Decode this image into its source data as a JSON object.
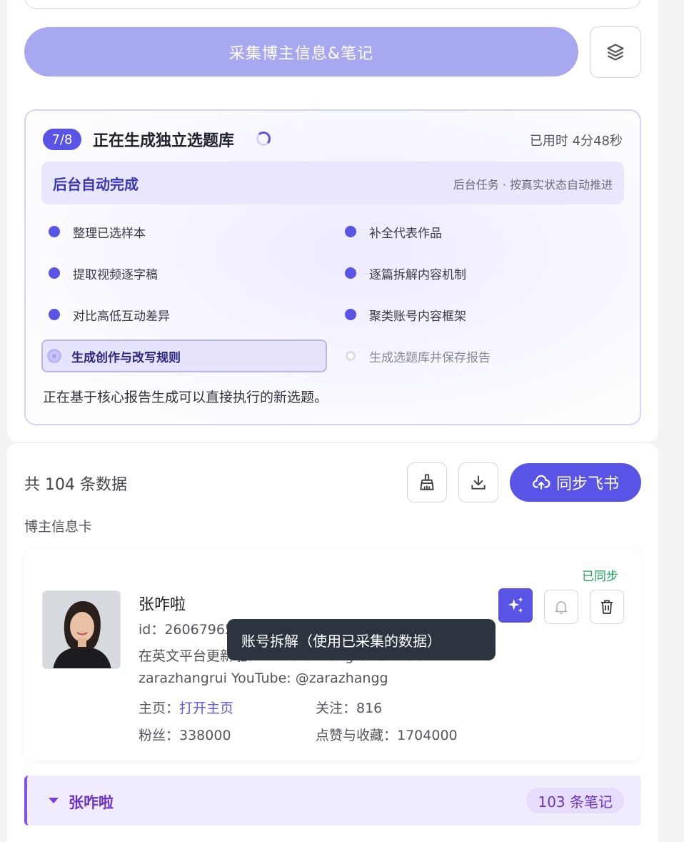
{
  "collect": {
    "button_label": "采集博主信息&笔记"
  },
  "progress": {
    "step_badge": "7/8",
    "title": "正在生成独立选题库",
    "elapsed": "已用时 4分48秒",
    "banner_title": "后台自动完成",
    "banner_note": "后台任务 · 按真实状态自动推进",
    "steps": [
      {
        "label": "整理已选样本",
        "status": "done"
      },
      {
        "label": "补全代表作品",
        "status": "done"
      },
      {
        "label": "提取视频逐字稿",
        "status": "done"
      },
      {
        "label": "逐篇拆解内容机制",
        "status": "done"
      },
      {
        "label": "对比高低互动差异",
        "status": "done"
      },
      {
        "label": "聚类账号内容框架",
        "status": "done"
      },
      {
        "label": "生成创作与改写规则",
        "status": "active"
      },
      {
        "label": "生成选题库并保存报告",
        "status": "pending"
      }
    ],
    "description": "正在基于核心报告生成可以直接执行的新选题。"
  },
  "results": {
    "count_text": "共 104 条数据",
    "sync_label": "同步飞书",
    "section_label": "博主信息卡"
  },
  "profile": {
    "sync_status": "已同步",
    "name": "张咋啦",
    "id_line": "id：2606796552 Lin 「新加坡」",
    "bio": "在英文平台更新啦： X: zarazhangrui GitHub: zarazhangrui YouTube: @zarazhangg",
    "homepage_label": "主页：",
    "homepage_link": "打开主页",
    "following_label": "关注：816",
    "fans_label": "粉丝：338000",
    "likes_label": "点赞与收藏：1704000"
  },
  "tooltip": {
    "text": "账号拆解（使用已采集的数据）"
  },
  "group": {
    "name": "张咋啦",
    "count": "103 条笔记"
  },
  "colors": {
    "accent": "#5a54e6",
    "accent_light": "#a8a8f0",
    "synced": "#1ea45a",
    "group": "#6a34c8"
  }
}
